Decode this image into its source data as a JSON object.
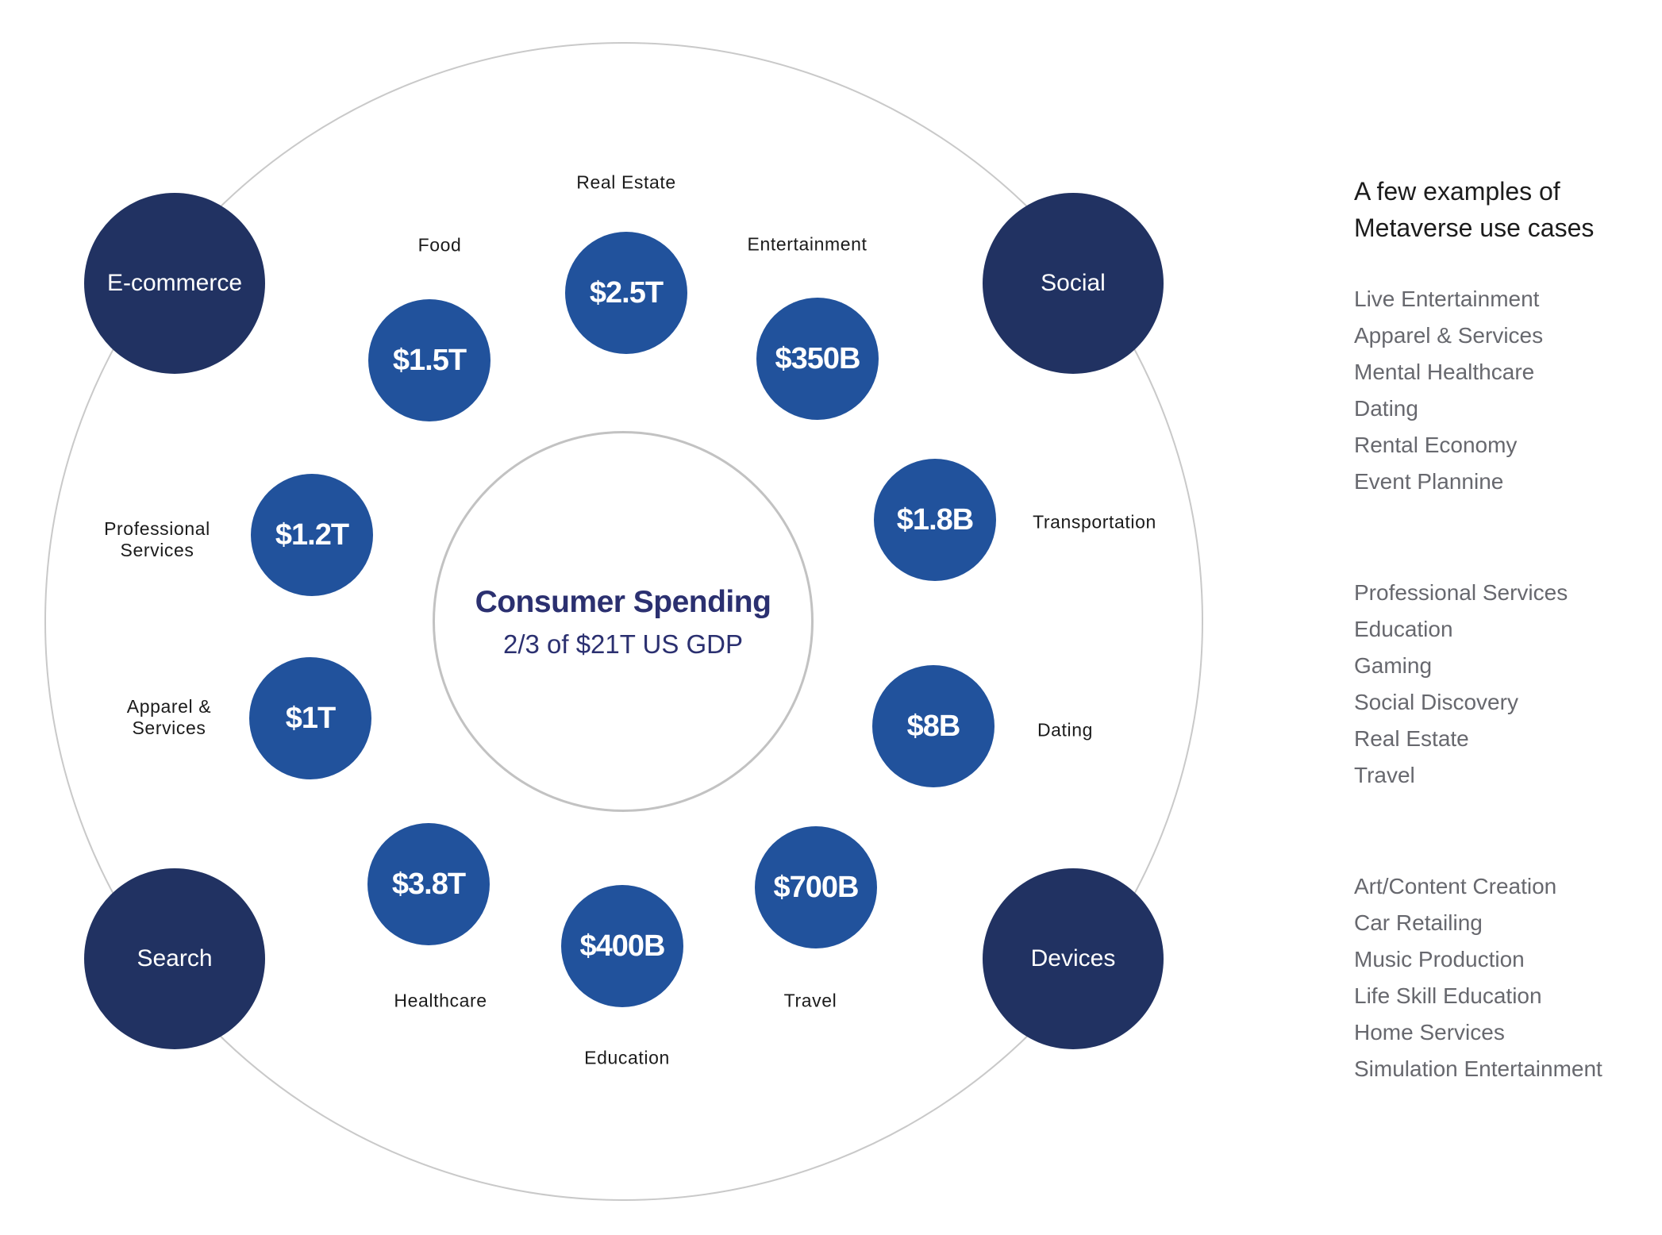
{
  "diagram": {
    "center": {
      "title": "Consumer Spending",
      "subtitle": "2/3 of $21T US GDP"
    },
    "platforms": [
      {
        "label": "E-commerce"
      },
      {
        "label": "Social"
      },
      {
        "label": "Search"
      },
      {
        "label": "Devices"
      }
    ],
    "sectors": [
      {
        "name": "Real Estate",
        "value": "$2.5T"
      },
      {
        "name": "Entertainment",
        "value": "$350B"
      },
      {
        "name": "Transportation",
        "value": "$1.8B"
      },
      {
        "name": "Dating",
        "value": "$8B"
      },
      {
        "name": "Travel",
        "value": "$700B"
      },
      {
        "name": "Education",
        "value": "$400B"
      },
      {
        "name": "Healthcare",
        "value": "$3.8T"
      },
      {
        "name": "Apparel &\nServices",
        "value": "$1T"
      },
      {
        "name": "Professional\nServices",
        "value": "$1.2T"
      },
      {
        "name": "Food",
        "value": "$1.5T"
      }
    ],
    "colors": {
      "platform": "#213262",
      "sector": "#21529c",
      "center_text": "#2b3070",
      "ring": "#c9c9c9"
    }
  },
  "sidebar": {
    "heading_line1": "A few examples of",
    "heading_line2": "Metaverse use cases",
    "groups": [
      {
        "items": [
          "Live Entertainment",
          "Apparel & Services",
          "Mental Healthcare",
          "Dating",
          "Rental Economy",
          "Event Plannine"
        ]
      },
      {
        "items": [
          "Professional Services",
          "Education",
          "Gaming",
          "Social Discovery",
          "Real Estate",
          "Travel"
        ]
      },
      {
        "items": [
          "Art/Content Creation",
          "Car Retailing",
          "Music Production",
          "Life Skill Education",
          "Home Services",
          "Simulation Entertainment"
        ]
      }
    ]
  }
}
